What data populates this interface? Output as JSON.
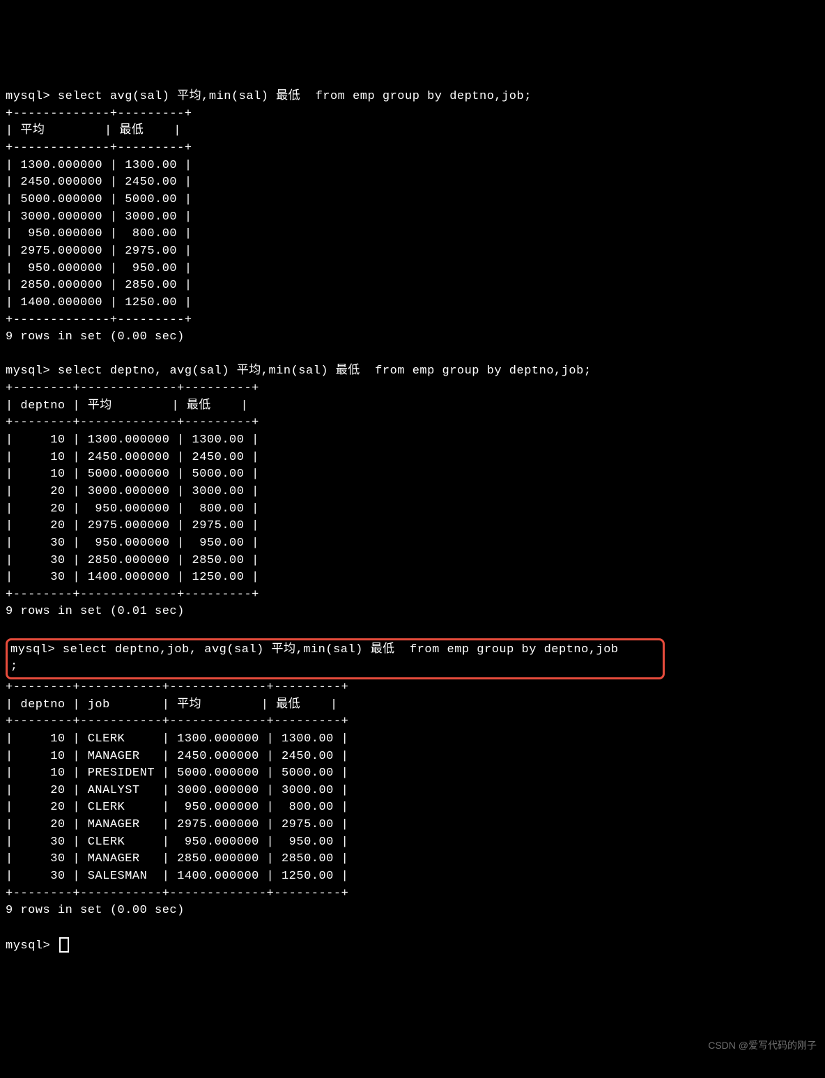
{
  "prompt": "mysql> ",
  "query1": {
    "sql": "select avg(sal) 平均,min(sal) 最低  from emp group by deptno,job;",
    "border_top": "+-------------+---------+",
    "header": "| 平均        | 最低    |",
    "cols": {
      "avg_w": 11,
      "min_w": 7
    },
    "rows": [
      {
        "avg": "1300.000000",
        "min": "1300.00"
      },
      {
        "avg": "2450.000000",
        "min": "2450.00"
      },
      {
        "avg": "5000.000000",
        "min": "5000.00"
      },
      {
        "avg": "3000.000000",
        "min": "3000.00"
      },
      {
        "avg": " 950.000000",
        "min": " 800.00"
      },
      {
        "avg": "2975.000000",
        "min": "2975.00"
      },
      {
        "avg": " 950.000000",
        "min": " 950.00"
      },
      {
        "avg": "2850.000000",
        "min": "2850.00"
      },
      {
        "avg": "1400.000000",
        "min": "1250.00"
      }
    ],
    "footer": "9 rows in set (0.00 sec)"
  },
  "query2": {
    "sql": "select deptno, avg(sal) 平均,min(sal) 最低  from emp group by deptno,job;",
    "border_top": "+--------+-------------+---------+",
    "header": "| deptno | 平均        | 最低    |",
    "cols": {
      "dep_w": 6,
      "avg_w": 11,
      "min_w": 7
    },
    "rows": [
      {
        "deptno": "10",
        "avg": "1300.000000",
        "min": "1300.00"
      },
      {
        "deptno": "10",
        "avg": "2450.000000",
        "min": "2450.00"
      },
      {
        "deptno": "10",
        "avg": "5000.000000",
        "min": "5000.00"
      },
      {
        "deptno": "20",
        "avg": "3000.000000",
        "min": "3000.00"
      },
      {
        "deptno": "20",
        "avg": " 950.000000",
        "min": " 800.00"
      },
      {
        "deptno": "20",
        "avg": "2975.000000",
        "min": "2975.00"
      },
      {
        "deptno": "30",
        "avg": " 950.000000",
        "min": " 950.00"
      },
      {
        "deptno": "30",
        "avg": "2850.000000",
        "min": "2850.00"
      },
      {
        "deptno": "30",
        "avg": "1400.000000",
        "min": "1250.00"
      }
    ],
    "footer": "9 rows in set (0.01 sec)"
  },
  "query3": {
    "sql_line1": "mysql> select deptno,job, avg(sal) 平均,min(sal) 最低  from emp group by deptno,job",
    "sql_line2": ";",
    "border_top": "+--------+-----------+-------------+---------+",
    "header": "| deptno | job       | 平均        | 最低    |",
    "cols": {
      "dep_w": 6,
      "job_w": 9,
      "avg_w": 11,
      "min_w": 7
    },
    "rows": [
      {
        "deptno": "10",
        "job": "CLERK",
        "avg": "1300.000000",
        "min": "1300.00"
      },
      {
        "deptno": "10",
        "job": "MANAGER",
        "avg": "2450.000000",
        "min": "2450.00"
      },
      {
        "deptno": "10",
        "job": "PRESIDENT",
        "avg": "5000.000000",
        "min": "5000.00"
      },
      {
        "deptno": "20",
        "job": "ANALYST",
        "avg": "3000.000000",
        "min": "3000.00"
      },
      {
        "deptno": "20",
        "job": "CLERK",
        "avg": " 950.000000",
        "min": " 800.00"
      },
      {
        "deptno": "20",
        "job": "MANAGER",
        "avg": "2975.000000",
        "min": "2975.00"
      },
      {
        "deptno": "30",
        "job": "CLERK",
        "avg": " 950.000000",
        "min": " 950.00"
      },
      {
        "deptno": "30",
        "job": "MANAGER",
        "avg": "2850.000000",
        "min": "2850.00"
      },
      {
        "deptno": "30",
        "job": "SALESMAN",
        "avg": "1400.000000",
        "min": "1250.00"
      }
    ],
    "footer": "9 rows in set (0.00 sec)"
  },
  "watermark": "CSDN @爱写代码的刚子"
}
